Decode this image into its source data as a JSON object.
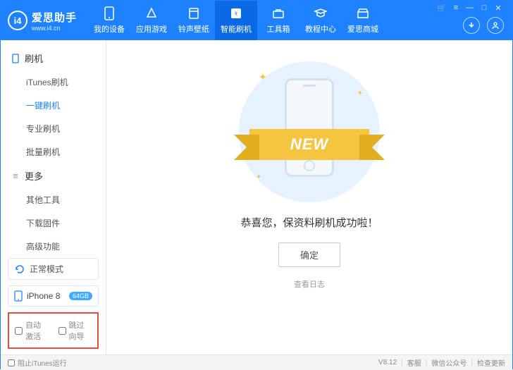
{
  "header": {
    "appName": "爱思助手",
    "url": "www.i4.cn",
    "logoText": "i4",
    "nav": [
      {
        "label": "我的设备"
      },
      {
        "label": "应用游戏"
      },
      {
        "label": "铃声壁纸"
      },
      {
        "label": "智能刷机"
      },
      {
        "label": "工具箱"
      },
      {
        "label": "教程中心"
      },
      {
        "label": "爱思商城"
      }
    ]
  },
  "sidebar": {
    "sections": [
      {
        "title": "刷机",
        "items": [
          {
            "label": "iTunes刷机"
          },
          {
            "label": "一键刷机"
          },
          {
            "label": "专业刷机"
          },
          {
            "label": "批量刷机"
          }
        ]
      },
      {
        "title": "更多",
        "items": [
          {
            "label": "其他工具"
          },
          {
            "label": "下载固件"
          },
          {
            "label": "高级功能"
          }
        ]
      }
    ],
    "mode": "正常模式",
    "device": {
      "name": "iPhone 8",
      "storage": "64GB"
    },
    "checks": {
      "autoActivate": "自动激活",
      "skipGuide": "跳过向导"
    }
  },
  "main": {
    "ribbon": "NEW",
    "message": "恭喜您，保资料刷机成功啦！",
    "okButton": "确定",
    "viewLog": "查看日志"
  },
  "footer": {
    "blockItunes": "阻止iTunes运行",
    "version": "V8.12",
    "links": [
      "客服",
      "微信公众号",
      "检查更新"
    ]
  }
}
